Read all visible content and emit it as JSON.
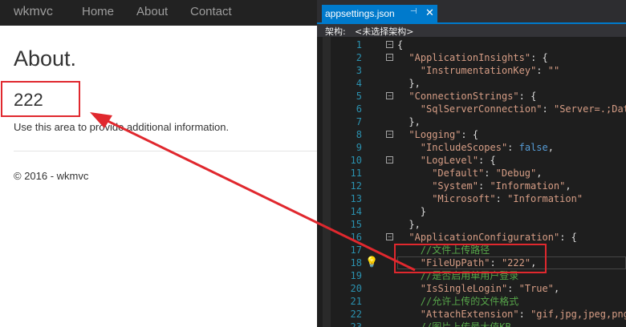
{
  "site": {
    "brand": "wkmvc",
    "nav": [
      "Home",
      "About",
      "Contact"
    ],
    "title": "About.",
    "value": "222",
    "info": "Use this area to provide additional information.",
    "footer": "© 2016 - wkmvc"
  },
  "editor": {
    "tab_title": "appsettings.json",
    "pin_glyph": "⊣",
    "close_glyph": "✕",
    "nav_label": "架构:",
    "nav_value": "<未选择架构>",
    "lines": [
      {
        "n": "1",
        "fold": "minus",
        "indent": 0,
        "parts": [
          [
            "p",
            "{"
          ]
        ]
      },
      {
        "n": "2",
        "fold": "minus",
        "indent": 1,
        "parts": [
          [
            "k",
            "\"ApplicationInsights\""
          ],
          [
            "p",
            ": {"
          ]
        ]
      },
      {
        "n": "3",
        "fold": "",
        "indent": 2,
        "parts": [
          [
            "k",
            "\"InstrumentationKey\""
          ],
          [
            "p",
            ": "
          ],
          [
            "s",
            "\"\""
          ]
        ]
      },
      {
        "n": "4",
        "fold": "",
        "indent": 1,
        "parts": [
          [
            "p",
            "},"
          ]
        ]
      },
      {
        "n": "5",
        "fold": "minus",
        "indent": 1,
        "parts": [
          [
            "k",
            "\"ConnectionStrings\""
          ],
          [
            "p",
            ": {"
          ]
        ]
      },
      {
        "n": "6",
        "fold": "",
        "indent": 2,
        "parts": [
          [
            "k",
            "\"SqlServerConnection\""
          ],
          [
            "p",
            ": "
          ],
          [
            "s",
            "\"Server=.;Data"
          ]
        ]
      },
      {
        "n": "7",
        "fold": "",
        "indent": 1,
        "parts": [
          [
            "p",
            "},"
          ]
        ]
      },
      {
        "n": "8",
        "fold": "minus",
        "indent": 1,
        "parts": [
          [
            "k",
            "\"Logging\""
          ],
          [
            "p",
            ": {"
          ]
        ]
      },
      {
        "n": "9",
        "fold": "",
        "indent": 2,
        "parts": [
          [
            "k",
            "\"IncludeScopes\""
          ],
          [
            "p",
            ": "
          ],
          [
            "b",
            "false"
          ],
          [
            "p",
            ","
          ]
        ]
      },
      {
        "n": "10",
        "fold": "minus",
        "indent": 2,
        "parts": [
          [
            "k",
            "\"LogLevel\""
          ],
          [
            "p",
            ": {"
          ]
        ]
      },
      {
        "n": "11",
        "fold": "",
        "indent": 3,
        "parts": [
          [
            "k",
            "\"Default\""
          ],
          [
            "p",
            ": "
          ],
          [
            "s",
            "\"Debug\""
          ],
          [
            "p",
            ","
          ]
        ]
      },
      {
        "n": "12",
        "fold": "",
        "indent": 3,
        "parts": [
          [
            "k",
            "\"System\""
          ],
          [
            "p",
            ": "
          ],
          [
            "s",
            "\"Information\""
          ],
          [
            "p",
            ","
          ]
        ]
      },
      {
        "n": "13",
        "fold": "",
        "indent": 3,
        "parts": [
          [
            "k",
            "\"Microsoft\""
          ],
          [
            "p",
            ": "
          ],
          [
            "s",
            "\"Information\""
          ]
        ]
      },
      {
        "n": "14",
        "fold": "",
        "indent": 2,
        "parts": [
          [
            "p",
            "}"
          ]
        ]
      },
      {
        "n": "15",
        "fold": "",
        "indent": 1,
        "parts": [
          [
            "p",
            "},"
          ]
        ]
      },
      {
        "n": "16",
        "fold": "minus",
        "indent": 1,
        "parts": [
          [
            "k",
            "\"ApplicationConfiguration\""
          ],
          [
            "p",
            ": {"
          ]
        ]
      },
      {
        "n": "17",
        "fold": "",
        "indent": 2,
        "parts": [
          [
            "c",
            "//文件上传路径"
          ]
        ]
      },
      {
        "n": "18",
        "fold": "",
        "indent": 2,
        "parts": [
          [
            "pk",
            "\"FileUpPath\""
          ],
          [
            "p",
            ": "
          ],
          [
            "s",
            "\"222\""
          ],
          [
            "p",
            ","
          ]
        ]
      },
      {
        "n": "19",
        "fold": "",
        "indent": 2,
        "parts": [
          [
            "c",
            "//是否启用单用户登录"
          ]
        ]
      },
      {
        "n": "20",
        "fold": "",
        "indent": 2,
        "parts": [
          [
            "k",
            "\"IsSingleLogin\""
          ],
          [
            "p",
            ": "
          ],
          [
            "s",
            "\"True\""
          ],
          [
            "p",
            ","
          ]
        ]
      },
      {
        "n": "21",
        "fold": "",
        "indent": 2,
        "parts": [
          [
            "c",
            "//允许上传的文件格式"
          ]
        ]
      },
      {
        "n": "22",
        "fold": "",
        "indent": 2,
        "parts": [
          [
            "k",
            "\"AttachExtension\""
          ],
          [
            "p",
            ": "
          ],
          [
            "s",
            "\"gif,jpg,jpeg,png,"
          ]
        ]
      },
      {
        "n": "23",
        "fold": "",
        "indent": 2,
        "parts": [
          [
            "c",
            "//图片上传最大值KB"
          ]
        ]
      }
    ]
  },
  "colors": {
    "annotation": "#e0282e",
    "navbar": "#222222",
    "editor_bg": "#1e1e1e",
    "tab_active": "#007acc"
  }
}
